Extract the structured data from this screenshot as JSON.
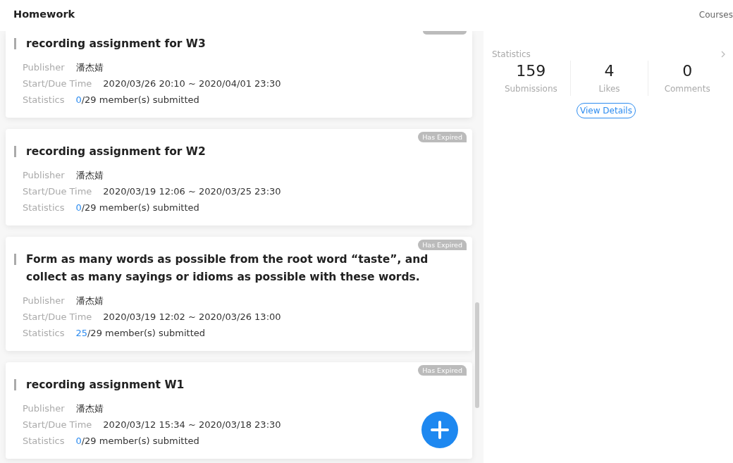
{
  "header": {
    "title": "Homework",
    "link": "Courses"
  },
  "assignments": [
    {
      "title": "recording assignment for W3",
      "publisher_label": "Publisher",
      "publisher": "潘杰婧",
      "time_label": "Start/Due Time",
      "time": "2020/03/26 20:10 ~ 2020/04/01 23:30",
      "stats_label": "Statistics",
      "submitted": "0",
      "stats_rest": "/29 member(s) submitted",
      "expired": true
    },
    {
      "title": "recording assignment for W2",
      "publisher_label": "Publisher",
      "publisher": "潘杰婧",
      "time_label": "Start/Due Time",
      "time": "2020/03/19 12:06 ~ 2020/03/25 23:30",
      "stats_label": "Statistics",
      "submitted": "0",
      "stats_rest": "/29 member(s) submitted",
      "expired_badge": "Has Expired"
    },
    {
      "title": "Form as many words as possible from the root word “taste”, and collect as many sayings or idioms as possible with these words.",
      "publisher_label": "Publisher",
      "publisher": "潘杰婧",
      "time_label": "Start/Due Time",
      "time": "2020/03/19 12:02 ~ 2020/03/26 13:00",
      "stats_label": "Statistics",
      "submitted": "25",
      "stats_rest": "/29 member(s) submitted",
      "expired_badge": "Has Expired"
    },
    {
      "title": "recording assignment W1",
      "publisher_label": "Publisher",
      "publisher": "潘杰婧",
      "time_label": "Start/Due Time",
      "time": "2020/03/12 15:34 ~ 2020/03/18 23:30",
      "stats_label": "Statistics",
      "submitted": "0",
      "stats_rest": "/29 member(s) submitted",
      "expired_badge": "Has Expired"
    }
  ],
  "statistics": {
    "title": "Statistics",
    "metrics": [
      {
        "value": "159",
        "label": "Submissions"
      },
      {
        "value": "4",
        "label": "Likes"
      },
      {
        "value": "0",
        "label": "Comments"
      }
    ],
    "button": "View Details"
  }
}
